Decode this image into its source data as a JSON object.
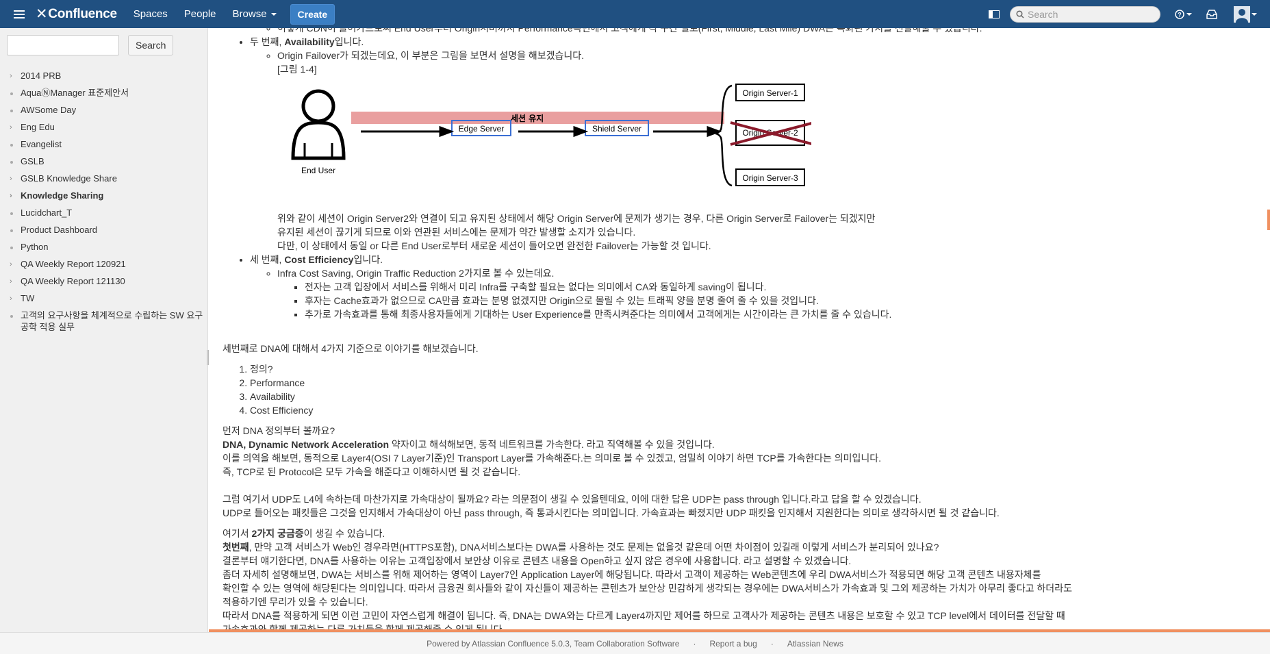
{
  "header": {
    "brand": "Confluence",
    "nav": [
      "Spaces",
      "People",
      "Browse"
    ],
    "create_label": "Create",
    "search_placeholder": "Search",
    "color": "#205081"
  },
  "sidebar": {
    "search_button": "Search",
    "items": [
      {
        "label": "2014 PRB",
        "type": "expand"
      },
      {
        "label": "AquaⓃManager 표준제안서",
        "type": "leaf"
      },
      {
        "label": "AWSome Day",
        "type": "leaf"
      },
      {
        "label": "Eng Edu",
        "type": "expand"
      },
      {
        "label": "Evangelist",
        "type": "leaf"
      },
      {
        "label": "GSLB",
        "type": "leaf"
      },
      {
        "label": "GSLB Knowledge Share",
        "type": "expand"
      },
      {
        "label": "Knowledge Sharing",
        "type": "expand",
        "active": true
      },
      {
        "label": "Lucidchart_T",
        "type": "leaf"
      },
      {
        "label": "Product Dashboard",
        "type": "leaf"
      },
      {
        "label": "Python",
        "type": "leaf"
      },
      {
        "label": "QA Weekly Report 120921",
        "type": "expand"
      },
      {
        "label": "QA Weekly Report 121130",
        "type": "expand"
      },
      {
        "label": "TW",
        "type": "expand"
      },
      {
        "label": "고객의 요구사항을 체계적으로 수립하는 SW 요구공학 적용 실무",
        "type": "leaf"
      }
    ]
  },
  "content": {
    "cut_line": "이렇게 CDN이 들어가므로써 End User부터 Origin서버까지 Performance측면에서 고객에게 각 구간 별로(First, Middle, Last Mile) DWA는 특화된 가치를 전달해줄 수 있습니다.",
    "second_pre": "두 번째, ",
    "second_bold": "Availability",
    "second_post": "입니다.",
    "failover": "Origin Failover가 되겠는데요, 이 부분은 그림을 보면서 설명을 해보겠습니다.",
    "fig_caption": "[그림 1-4]",
    "figure": {
      "user": "End User",
      "session": "세션 유지",
      "edge": "Edge Server",
      "shield": "Shield Server",
      "origins": [
        "Origin Server-1",
        "Origin Server-2",
        "Origin Server-3"
      ]
    },
    "after_fig": [
      "위와 같이 세션이  Origin Server2와 연결이 되고 유지된 상태에서 해당 Origin Server에 문제가 생기는 경우, 다른 Origin Server로  Failover는 되겠지만",
      "유지된 세션이 끊기게 되므로 이와 연관된 서비스에는 문제가 약간 발생할 소지가 있습니다.",
      "다만, 이 상태에서 동일 or 다른 End User로부터 새로운 세션이 들어오면 완전한 Failover는 가능할 것 입니다."
    ],
    "third_pre": "세 번째, ",
    "third_bold": "Cost Efficiency",
    "third_post": "입니다.",
    "cost_intro": "Infra Cost Saving, Origin Traffic Reduction 2가지로 볼 수 있는데요.",
    "cost_items": [
      "전자는 고객 입장에서 서비스를 위해서 미리 Infra를 구축할 필요는 없다는 의미에서 CA와 동일하게 saving이 됩니다.",
      "후자는 Cache효과가 없으므로 CA만큼 효과는 분명 없겠지만 Origin으로 몰릴 수 있는 트래픽 양을 분명 줄여 줄 수 있을 것입니다.",
      "추가로 가속효과를 통해 최종사용자들에게 기대하는 User Experience를 만족시켜준다는 의미에서 고객에게는 시간이라는 큰 가치를 줄 수 있습니다."
    ],
    "dna_intro": "세번째로 DNA에 대해서 4가지 기준으로 이야기를 해보겠습니다.",
    "dna_list": [
      "정의?",
      "Performance",
      "Availability",
      "Cost Efficiency"
    ],
    "def_q": "먼저 DNA 정의부터 볼까요?",
    "def_bold": "DNA, Dynamic Network Acceleration",
    "def_rest": " 약자이고 해석해보면, 동적 네트워크를 가속한다. 라고 직역해볼 수 있을 것입니다.",
    "def_l2": "이를 의역을 해보면, 동적으로 Layer4(OSI 7 Layer기준)인 Transport Layer를 가속해준다.는 의미로 볼 수 있겠고, 엄밀히 이야기 하면 TCP를 가속한다는 의미입니다.",
    "def_l3": "즉, TCP로 된 Protocol은 모두 가속을 해준다고 이해하시면 될 것 같습니다.",
    "udp_l1": "그럼 여기서 UDP도 L4에 속하는데 마찬가지로 가속대상이 될까요? 라는 의문점이 생길 수 있을텐데요, 이에 대한 답은 UDP는 pass through 입니다.라고 답을 할 수 있겠습니다.",
    "udp_l2": "UDP로 들어오는 패킷들은 그것을 인지해서 가속대상이 아닌 pass through, 즉 통과시킨다는 의미입니다. 가속효과는 빠졌지만 UDP 패킷을 인지해서 지원한다는 의미로 생각하시면 될 것 같습니다.",
    "q_pre": "여기서 ",
    "q_bold": "2가지 궁금증",
    "q_post": "이 생길 수 있습니다.",
    "first_bold": "첫번째",
    "first_rest": ", 만약 고객 서비스가 Web인 경우라면(HTTPS포함), DNA서비스보다는 DWA를 사용하는 것도 문제는 없을것 같은데 어떤 차이점이 있길래 이렇게 서비스가 분리되어 있나요?",
    "ans1": "결론부터 얘기한다면, DNA를 사용하는 이유는 고객입장에서 보안상 이유로 콘텐츠 내용을 Open하고 싶지 않은 경우에 사용합니다. 라고 설명할 수 있겠습니다.",
    "ans2": "좀더 자세히 설명해보면, DWA는 서비스를 위해 제어하는 영역이 Layer7인 Application Layer에 해당됩니다. 따라서 고객이 제공하는 Web콘텐츠에 우리 DWA서비스가 적용되면 해당 고객 콘텐츠 내용자체를",
    "ans3": "확인할 수 있는 영역에 해당된다는 의미입니다. 따라서 금융권 회사들와 같이 자신들이 제공하는 콘텐츠가 보안상 민감하게 생각되는 경우에는 DWA서비스가 가속효과 및 그외 제공하는 가치가 아무리 좋다고 하더라도",
    "ans4": "적용하기엔 무리가 있을 수 있습니다.",
    "ans5": "따라서 DNA를 적용하게 되면 이런 고민이 자연스럽게 해결이 됩니다. 즉, DNA는 DWA와는 다르게 Layer4까지만 제어를 하므로 고객사가 제공하는 콘텐츠 내용은 보호할 수 있고 TCP level에서 데이터를 전달할 때",
    "ans6": "가속효과와 함께 제공하는 다른 가치들을 함께 제공해줄 수 있게 됩니다."
  },
  "footer": {
    "powered": "Powered by Atlassian Confluence 5.0.3, Team Collaboration Software",
    "bug": "Report a bug",
    "news": "Atlassian News"
  }
}
